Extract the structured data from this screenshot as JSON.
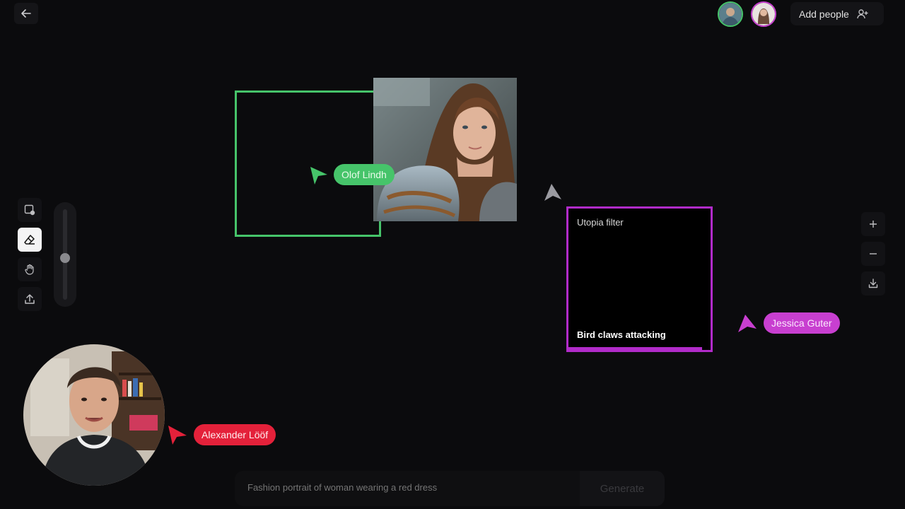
{
  "header": {
    "add_people_label": "Add people"
  },
  "collaborators": [
    {
      "name": "Olof Lindh",
      "color": "#46c46a"
    },
    {
      "name": "Jessica Guter",
      "color": "#c83fd0"
    },
    {
      "name": "Alexander Lööf",
      "color": "#e4213a"
    }
  ],
  "canvas": {
    "filter_frame": {
      "title": "Utopia filter",
      "caption": "Bird claws attacking",
      "progress": 0.94
    }
  },
  "toolbar": {
    "tools": [
      "frame-add-icon",
      "eraser-icon",
      "hand-icon",
      "upload-icon"
    ],
    "active_tool": "eraser-icon",
    "brush_size_level": 0.46
  },
  "zoom_controls": [
    "plus-icon",
    "minus-icon",
    "download-icon"
  ],
  "prompt": {
    "placeholder": "Fashion portrait of woman wearing a red dress",
    "generate_label": "Generate"
  },
  "colors": {
    "accent_green": "#46c46a",
    "accent_magenta": "#b12bc9",
    "accent_red": "#e4213a",
    "background": "#0b0b0d"
  }
}
